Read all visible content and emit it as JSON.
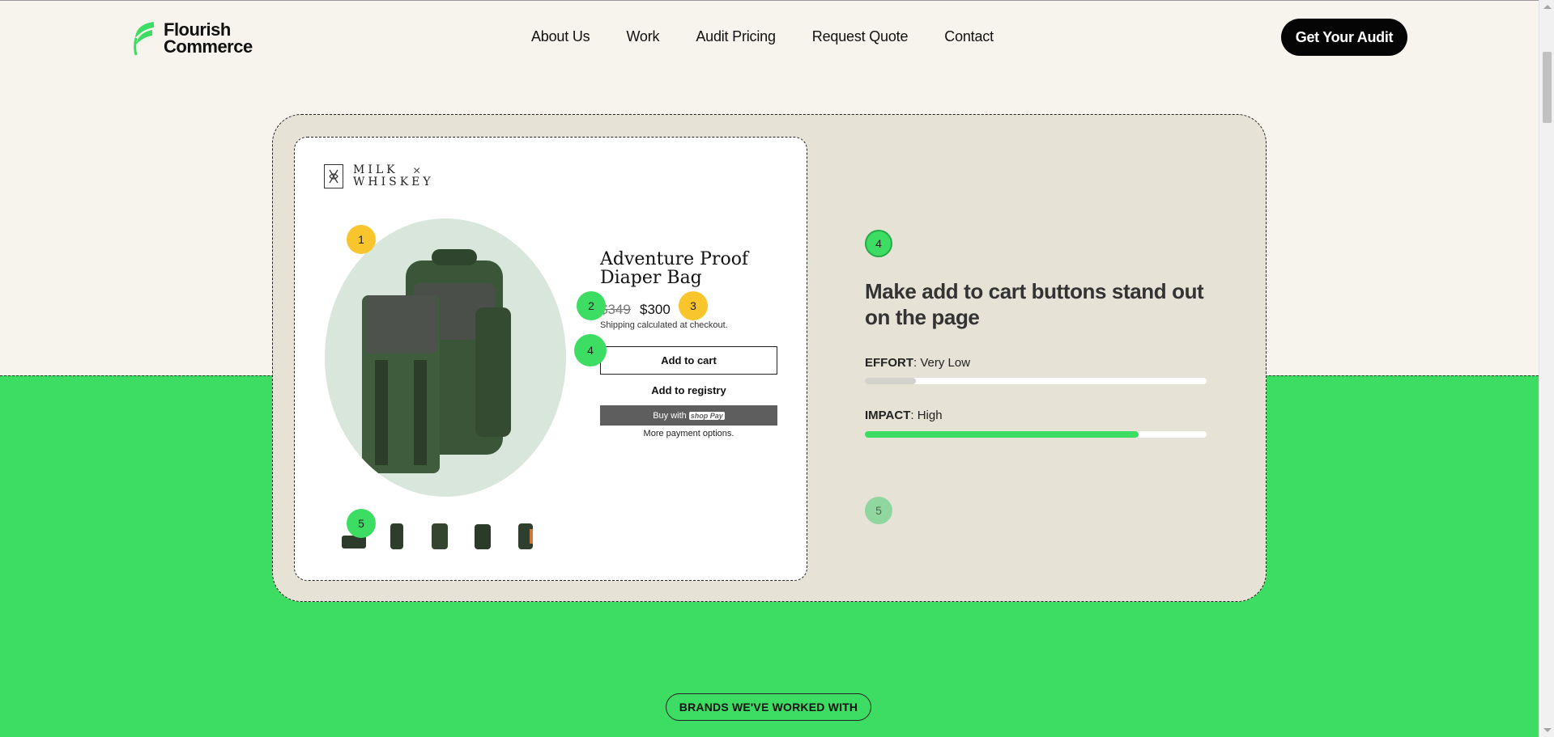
{
  "header": {
    "logo_line1": "Flourish",
    "logo_line2": "Commerce",
    "nav": [
      "About Us",
      "Work",
      "Audit Pricing",
      "Request Quote",
      "Contact"
    ],
    "cta_label": "Get Your Audit"
  },
  "product": {
    "brand_line1": "MILK",
    "brand_line2": "WHISKEY",
    "brand_x": "×",
    "title": "Adventure Proof Diaper Bag",
    "price_old": "$349",
    "price_new": "$300",
    "shipping_note": "Shipping calculated at checkout.",
    "add_to_cart": "Add to cart",
    "add_to_registry": "Add to registry",
    "buy_with": "Buy with",
    "shop_pay": "shop Pay",
    "more_payment": "More payment options."
  },
  "markers": {
    "m1": "1",
    "m2": "2",
    "m3": "3",
    "m4": "4",
    "m5": "5"
  },
  "tip": {
    "number": "4",
    "heading": "Make add to cart buttons stand out on the page",
    "effort_label": "EFFORT",
    "effort_value": ": Very Low",
    "effort_level": 0.15,
    "impact_label": "IMPACT",
    "impact_value": ": High",
    "impact_level": 0.8,
    "next_number": "5"
  },
  "brands_pill": "BRANDS WE'VE WORKED WITH",
  "colors": {
    "accent_green": "#3ddc63",
    "marker_yellow": "#f9c52c",
    "card_beige": "#e6e2d6",
    "page_bg": "#f6f4ec"
  }
}
